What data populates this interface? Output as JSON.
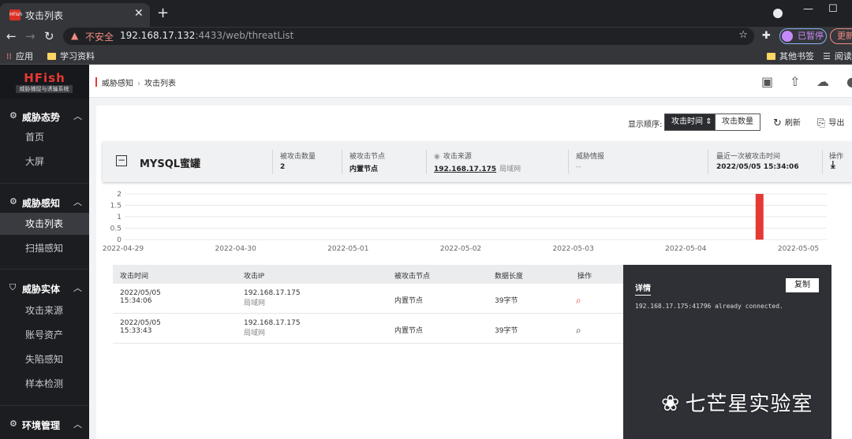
{
  "browser": {
    "tab_title": "攻击列表",
    "favicon_text": "HFish",
    "insecure_label": "不安全",
    "url_host": "192.168.17.132",
    "url_rest": ":4433/web/threatList",
    "paused_label": "已暂停",
    "update_label": "更新",
    "bookmarks": [
      "应用",
      "学习资料",
      "其他书签",
      "阅读"
    ]
  },
  "sidebar": {
    "logo": "HFish",
    "logo_sub": "威胁捕捉与诱骗系统",
    "groups": [
      {
        "label": "威胁态势",
        "items": [
          "首页",
          "大屏"
        ]
      },
      {
        "label": "威胁感知",
        "items": [
          "攻击列表",
          "扫描感知"
        ]
      },
      {
        "label": "威胁实体",
        "items": [
          "攻击来源",
          "账号资产",
          "失陷感知",
          "样本检测"
        ]
      },
      {
        "label": "环境管理",
        "items": []
      }
    ],
    "active_item": "攻击列表"
  },
  "header": {
    "crumb_parent": "威胁感知",
    "crumb_current": "攻击列表"
  },
  "toolbar": {
    "sort_label": "显示顺序:",
    "sort_time": "攻击时间",
    "sort_count": "攻击数量",
    "refresh": "刷新",
    "export": "导出"
  },
  "honeypot": {
    "name": "MYSQL蜜罐",
    "attack_count_label": "被攻击数量",
    "attack_count": "2",
    "node_label": "被攻击节点",
    "node": "内置节点",
    "source_label": "攻击来源",
    "source_ip": "192.168.17.175",
    "source_net": "局域网",
    "intel_label": "威胁情报",
    "intel": "--",
    "last_time_label": "最近一次被攻击时间",
    "last_time": "2022/05/05 15:34:06",
    "op_label": "操作"
  },
  "chart_data": {
    "type": "bar",
    "x": [
      "2022-04-29",
      "2022-04-30",
      "2022-05-01",
      "2022-05-02",
      "2022-05-03",
      "2022-05-04",
      "2022-05-05"
    ],
    "y_ticks": [
      "2",
      "1.5",
      "1",
      "0.5",
      "0"
    ],
    "bars": [
      {
        "date": "2022-05-05 (early)",
        "value": 2
      }
    ],
    "ylim": [
      0,
      2
    ],
    "bar_color": "#e53935"
  },
  "table": {
    "headers": [
      "攻击时间",
      "攻击IP",
      "被攻击节点",
      "数据长度",
      "操作"
    ],
    "rows": [
      {
        "date": "2022/05/05",
        "time": "15:34:06",
        "ip": "192.168.17.175",
        "net": "局域网",
        "node": "内置节点",
        "len": "39字节",
        "op_color": "#e53935"
      },
      {
        "date": "2022/05/05",
        "time": "15:33:43",
        "ip": "192.168.17.175",
        "net": "局域网",
        "node": "内置节点",
        "len": "39字节",
        "op_color": "#333333"
      }
    ]
  },
  "detail": {
    "title": "详情",
    "copy": "复制",
    "text": "192.168.17.175:41796 already connected."
  },
  "watermark": "七芒星实验室"
}
